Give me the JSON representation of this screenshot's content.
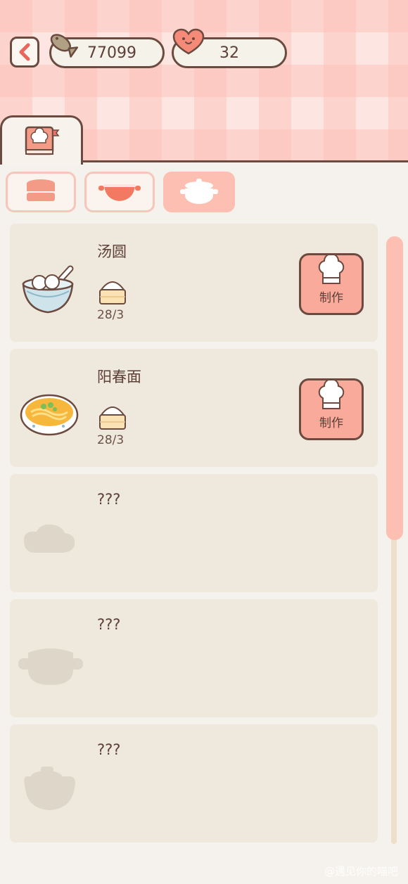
{
  "header": {
    "fish_count": "77099",
    "heart_count": "32"
  },
  "tabs": {
    "book_tab_icon": "recipe-book-icon",
    "categories": [
      {
        "icon": "steamer-icon",
        "active": false
      },
      {
        "icon": "wok-icon",
        "active": false
      },
      {
        "icon": "pot-icon",
        "active": true
      }
    ]
  },
  "recipes": [
    {
      "name": "汤圆",
      "dish_icon": "tangyuan-bowl-icon",
      "ingredient_icon": "dumpling-icon",
      "count": "28/3",
      "button": "制作"
    },
    {
      "name": "阳春面",
      "dish_icon": "noodle-bowl-icon",
      "ingredient_icon": "dumpling-icon",
      "count": "28/3",
      "button": "制作"
    },
    {
      "name": "???",
      "dish_icon": "locked-dish-icon"
    },
    {
      "name": "???",
      "dish_icon": "locked-pot-icon"
    },
    {
      "name": "???",
      "dish_icon": "locked-jar-icon"
    }
  ],
  "watermark": "@遇见你的喵吧",
  "colors": {
    "accent": "#f9aa9b",
    "outline": "#6b4a3f",
    "card": "#efe8dc",
    "scroll_thumb": "#fcbfb1"
  }
}
